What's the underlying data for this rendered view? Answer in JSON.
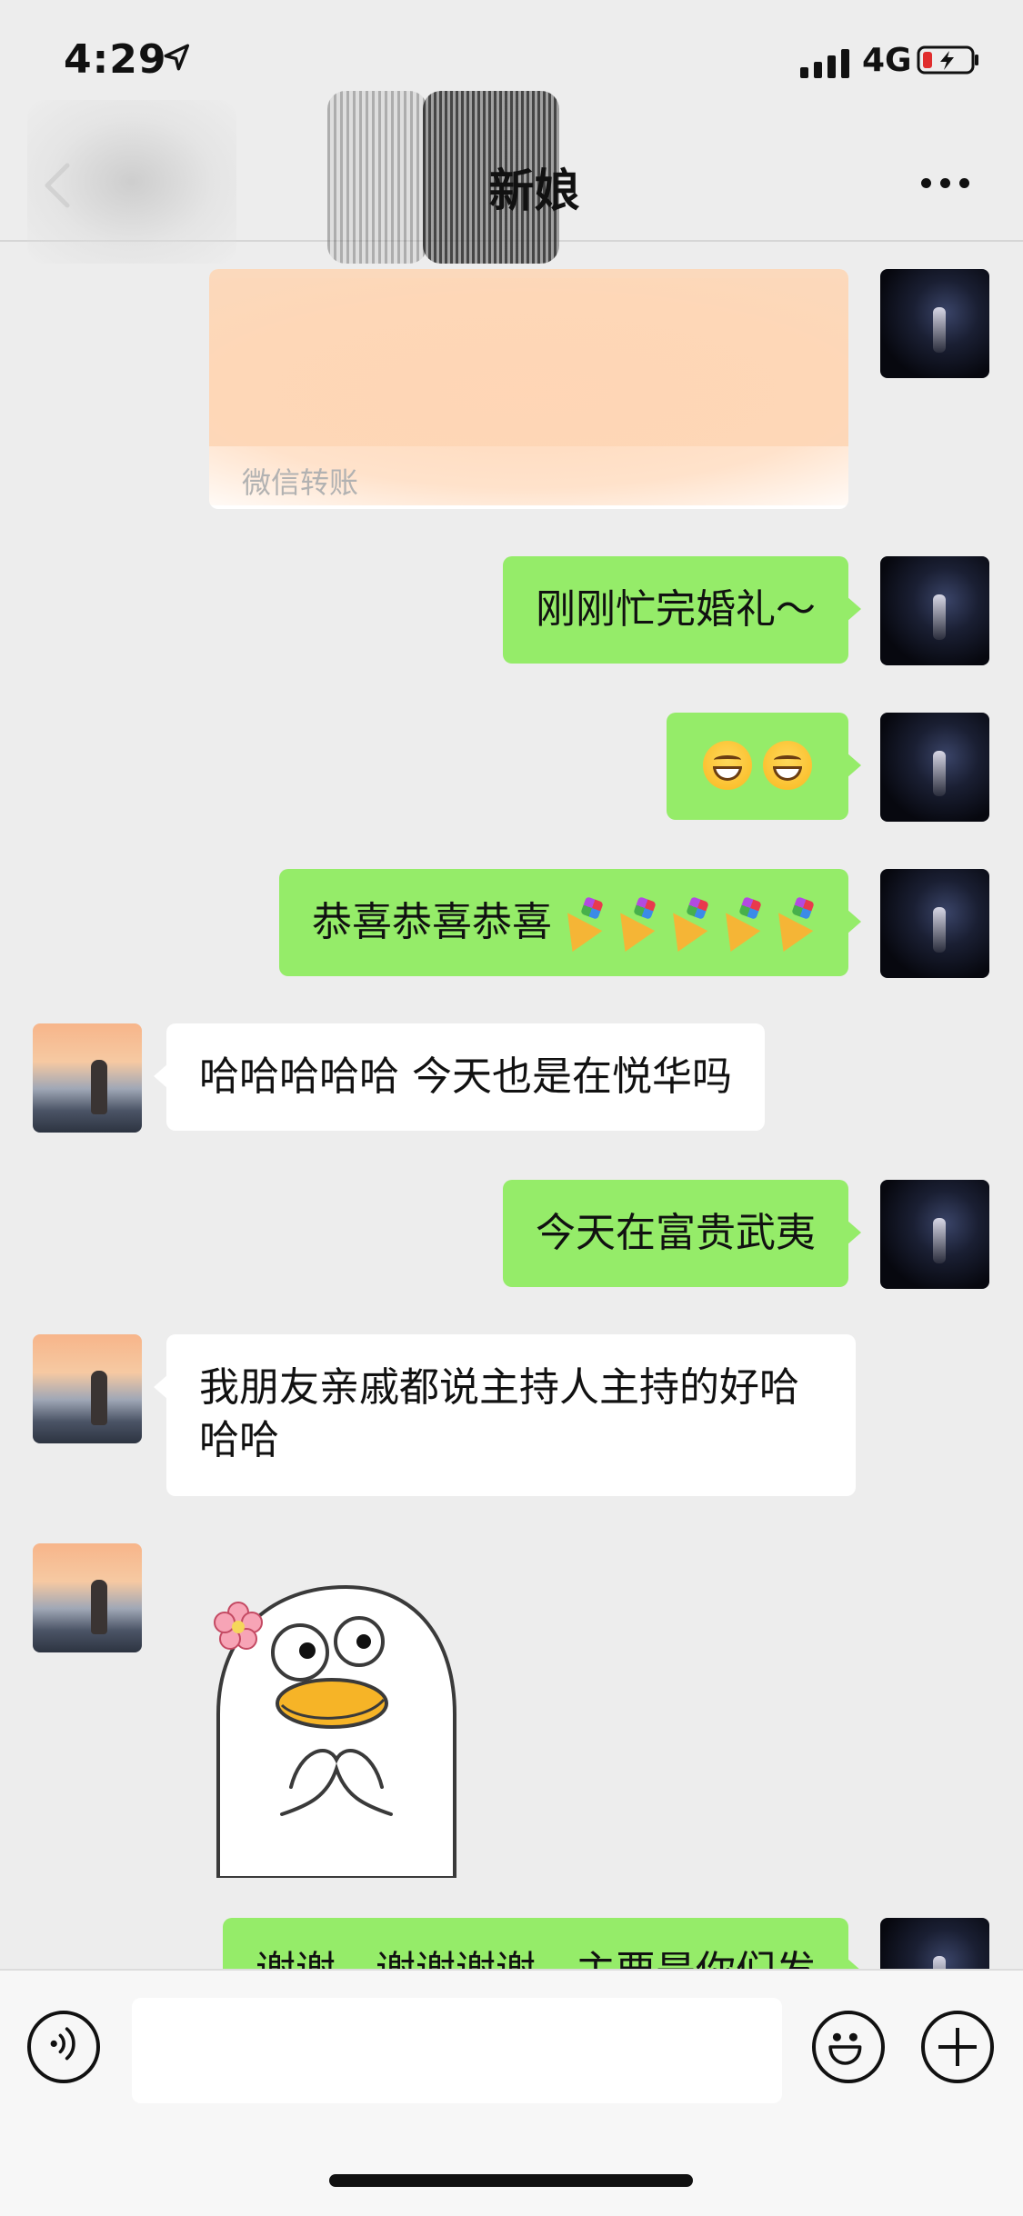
{
  "status_bar": {
    "time": "4:29",
    "network": "4G"
  },
  "nav": {
    "title": "新娘"
  },
  "messages": [
    {
      "side": "out",
      "type": "transfer",
      "label": "微信转账"
    },
    {
      "side": "out",
      "type": "text",
      "text": "刚刚忙完婚礼～"
    },
    {
      "side": "out",
      "type": "emoji",
      "emoji_count": 2,
      "icon": "grinning-face-icon"
    },
    {
      "side": "out",
      "type": "text",
      "text": "恭喜恭喜恭喜",
      "trailing_icons": 5,
      "icon": "party-popper-icon"
    },
    {
      "side": "in",
      "type": "text",
      "text": "哈哈哈哈哈 今天也是在悦华吗"
    },
    {
      "side": "out",
      "type": "text",
      "text": "今天在富贵武夷"
    },
    {
      "side": "in",
      "type": "text",
      "text": "我朋友亲戚都说主持人主持的好哈哈哈"
    },
    {
      "side": "in",
      "type": "sticker",
      "icon": "duck-sticker-icon"
    },
    {
      "side": "out",
      "type": "text",
      "text": "谢谢，谢谢谢谢，主要是你们发"
    }
  ],
  "input_bar": {
    "placeholder": "",
    "icons": [
      "voice-icon",
      "emoji-icon",
      "plus-icon"
    ]
  },
  "colors": {
    "bubble_out": "#95ec69",
    "bubble_in": "#ffffff",
    "background": "#ededed"
  }
}
